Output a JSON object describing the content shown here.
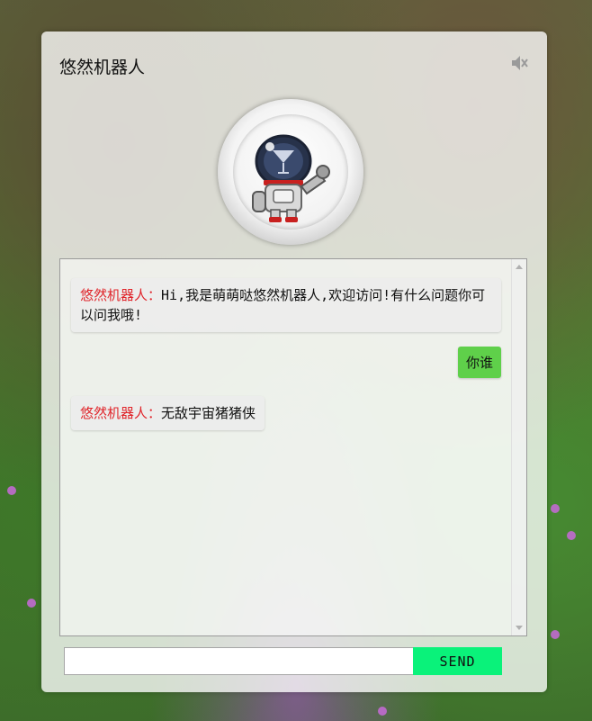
{
  "header": {
    "title": "悠然机器人",
    "mute_icon": "speaker-muted-icon"
  },
  "avatar": {
    "icon": "robot-astronaut-avatar"
  },
  "chat": {
    "messages": [
      {
        "from": "bot",
        "name": "悠然机器人：",
        "text": "Hi,我是萌萌哒悠然机器人,欢迎访问!有什么问题你可以问我哦!"
      },
      {
        "from": "user",
        "text": "你谁"
      },
      {
        "from": "bot",
        "name": "悠然机器人：",
        "text": "无敌宇宙猪猪侠"
      }
    ]
  },
  "composer": {
    "input_value": "",
    "send_label": "SEND"
  },
  "colors": {
    "bot_name": "#e0242a",
    "user_bubble": "#5fd04a",
    "send_button": "#0af27a"
  }
}
